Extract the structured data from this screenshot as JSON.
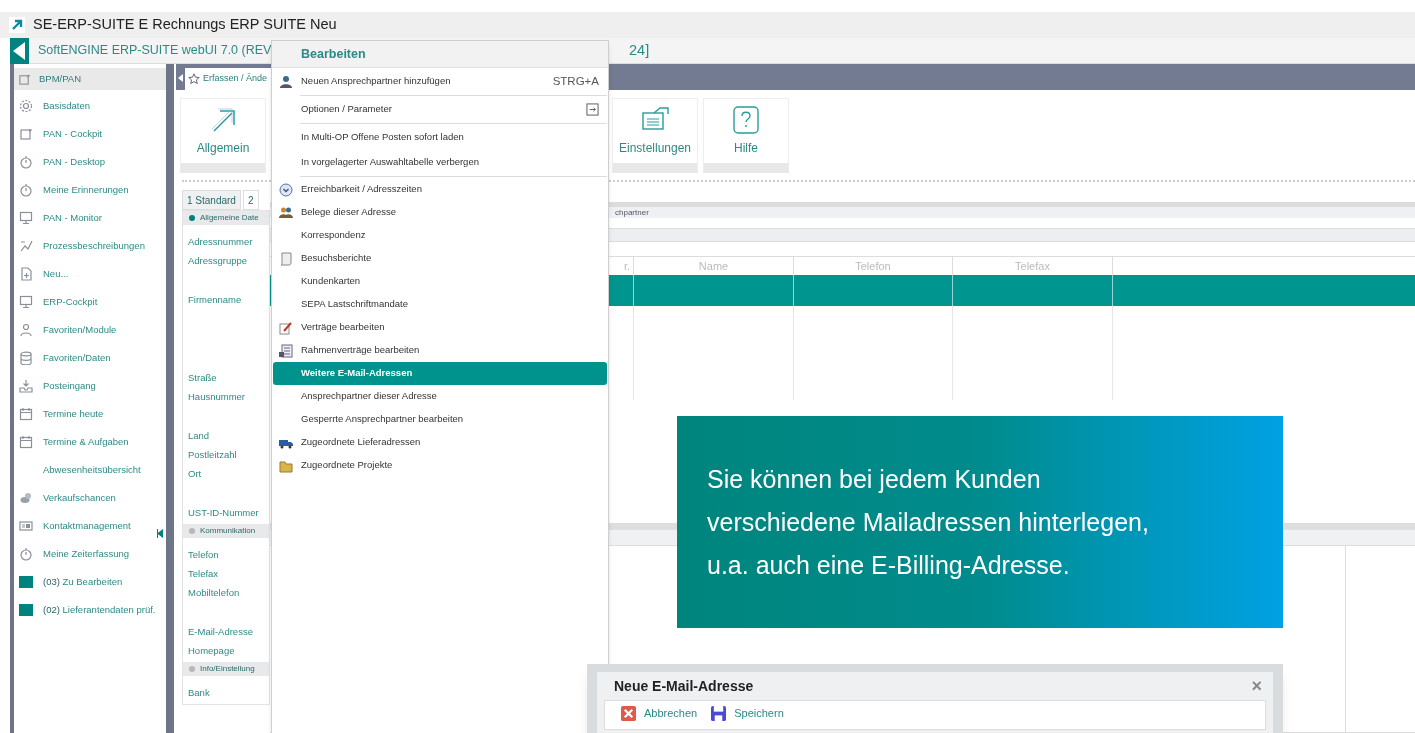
{
  "window": {
    "title": "SE-ERP-SUITE E Rechnungs ERP SUITE Neu"
  },
  "app_header": {
    "title": "SoftENGINE ERP-SUITE webUI 7.0 (REV",
    "title_end": "24]"
  },
  "sidebar": {
    "title": "BPM/PAN",
    "items": [
      {
        "label": "Basisdaten"
      },
      {
        "label": "PAN - Cockpit"
      },
      {
        "label": "PAN - Desktop"
      },
      {
        "label": "Meine Erinnerungen"
      },
      {
        "label": "PAN - Monitor"
      },
      {
        "label": "Prozessbeschreibungen"
      },
      {
        "label": "Neu..."
      },
      {
        "label": "ERP-Cockpit"
      },
      {
        "label": "Favoriten/Module"
      },
      {
        "label": "Favoriten/Daten"
      },
      {
        "label": "Posteingang"
      },
      {
        "label": "Termine heute"
      },
      {
        "label": "Termine & Aufgaben"
      },
      {
        "label": "Abwesenheitsübersicht"
      },
      {
        "label": "Verkaufschancen"
      },
      {
        "label": "Kontaktmanagement"
      },
      {
        "label": "Meine Zeiterfassung"
      },
      {
        "count": "(03)",
        "label": "Zu Bearbeiten"
      },
      {
        "count": "(02)",
        "label": "Lieferantendaten prüf."
      }
    ]
  },
  "main_tabs": [
    {
      "label": "Erfassen / Ände",
      "selected": true
    }
  ],
  "toolbar": [
    {
      "label": "Allgemein"
    },
    {
      "label": "Einstellungen"
    },
    {
      "label": "Hilfe"
    }
  ],
  "form_tabs": [
    {
      "label": "1 Standard",
      "selected": true
    },
    {
      "label": "2",
      "selected": false
    }
  ],
  "form_sections": [
    {
      "title": "Allgemeine Date",
      "active": true,
      "fields": [
        {
          "label": "Adressnummer",
          "kind": "line"
        },
        {
          "label": "Adressgruppe",
          "kind": "tall"
        },
        {
          "label": "Firmenname",
          "kind": "block"
        },
        {
          "label": "Straße",
          "kind": "line"
        },
        {
          "label": "Hausnummer",
          "kind": "tall"
        },
        {
          "label": "Land",
          "kind": "line"
        },
        {
          "label": "Postleitzahl",
          "kind": "line"
        },
        {
          "label": "Ort",
          "kind": "tall"
        },
        {
          "label": "UST-ID-Nummer",
          "kind": "line"
        }
      ]
    },
    {
      "title": "Kommunikation",
      "active": false,
      "fields": [
        {
          "label": "Telefon",
          "kind": "line"
        },
        {
          "label": "Telefax",
          "kind": "line"
        },
        {
          "label": "Mobiltelefon",
          "kind": "tall"
        },
        {
          "label": "E-Mail-Adresse",
          "kind": "line"
        },
        {
          "label": "Homepage",
          "kind": "line"
        }
      ]
    },
    {
      "title": "Info/Einstellung",
      "active": false,
      "fields": [
        {
          "label": "Bank",
          "kind": "line"
        }
      ]
    }
  ],
  "contacts": {
    "title": "chpartner",
    "columns": [
      "r.",
      "Name",
      "Telefon",
      "Telefax"
    ],
    "rows": [
      {
        "selected": true
      },
      {
        "selected": false
      }
    ]
  },
  "menu": {
    "title": "Bearbeiten",
    "items": [
      {
        "label": "Neuen Ansprechpartner hinzufügen",
        "shortcut": "STRG+A",
        "separator": true,
        "selected": false
      },
      {
        "label": "Optionen / Parameter",
        "separator": true,
        "selected": false
      },
      {
        "label": "In Multi-OP Offene Posten sofort laden",
        "separator": false,
        "selected": false
      },
      {
        "label": "In vorgelagerter Auswahltabelle verbergen",
        "separator": true,
        "selected": false
      },
      {
        "label": "Erreichbarkeit / Adresszeiten",
        "separator": false,
        "selected": false
      },
      {
        "label": "Belege dieser Adresse",
        "separator": false,
        "selected": false
      },
      {
        "label": "Korrespondenz",
        "separator": false,
        "selected": false
      },
      {
        "label": "Besuchsberichte",
        "separator": false,
        "selected": false
      },
      {
        "label": "Kundenkarten",
        "separator": false,
        "selected": false
      },
      {
        "label": "SEPA Lastschriftmandate",
        "separator": false,
        "selected": false
      },
      {
        "label": "Verträge bearbeiten",
        "separator": false,
        "selected": false
      },
      {
        "label": "Rahmenverträge bearbeiten",
        "separator": false,
        "selected": false
      },
      {
        "label": "Weitere E-Mail-Adressen",
        "separator": false,
        "selected": true
      },
      {
        "label": "Ansprechpartner dieser Adresse",
        "separator": false,
        "selected": false
      },
      {
        "label": "Gesperrte Ansprechpartner bearbeiten",
        "separator": false,
        "selected": false
      },
      {
        "label": "Zugeordnete Lieferadressen",
        "separator": false,
        "selected": false
      },
      {
        "label": "Zugeordnete Projekte",
        "separator": false,
        "selected": false
      }
    ]
  },
  "callout": {
    "text": "Sie können bei jedem Kunden verschiedene Mailadressen hinterlegen, u.a. auch eine E-Billing-Adresse."
  },
  "dialog": {
    "title": "Neue E-Mail-Adresse",
    "close": "×",
    "buttons": [
      {
        "label": "Abbrechen"
      },
      {
        "label": "Speichern"
      }
    ]
  }
}
